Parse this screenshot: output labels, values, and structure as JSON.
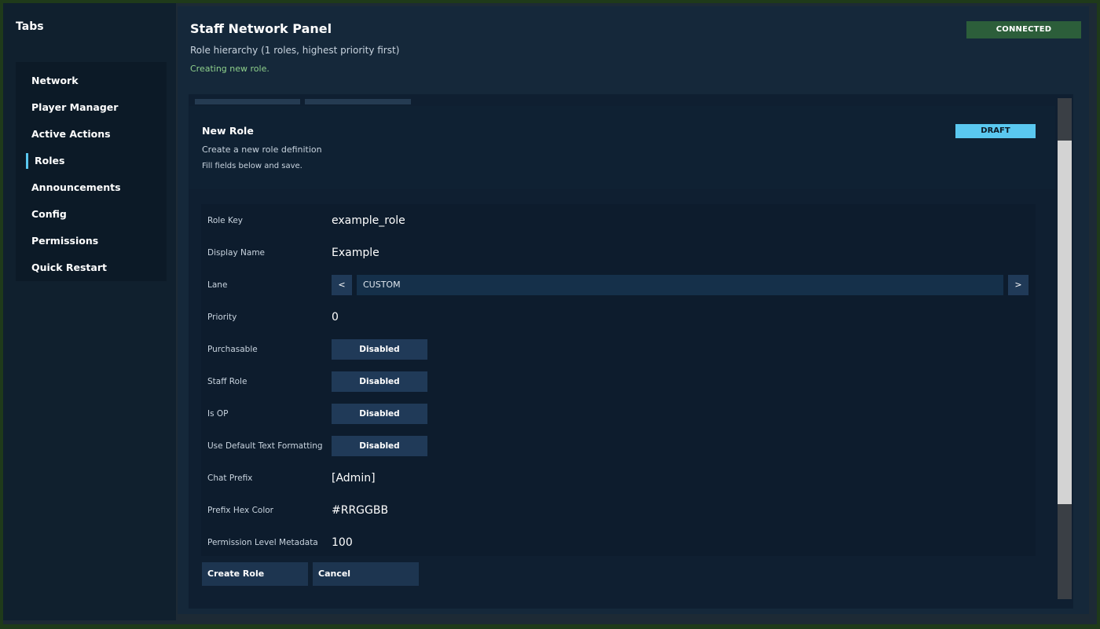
{
  "sidebar": {
    "title": "Tabs",
    "items": [
      {
        "label": "Network"
      },
      {
        "label": "Player Manager"
      },
      {
        "label": "Active Actions"
      },
      {
        "label": "Roles",
        "active": true
      },
      {
        "label": "Announcements"
      },
      {
        "label": "Config"
      },
      {
        "label": "Permissions"
      },
      {
        "label": "Quick Restart"
      }
    ]
  },
  "header": {
    "title": "Staff Network Panel",
    "subtitle": "Role hierarchy (1 roles, highest priority first)",
    "status": "Creating new role.",
    "connection_badge": "CONNECTED"
  },
  "form": {
    "title": "New Role",
    "description": "Create a new role definition",
    "hint": "Fill fields below and save.",
    "badge": "DRAFT",
    "fields": {
      "role_key": {
        "label": "Role Key",
        "value": "example_role"
      },
      "display_name": {
        "label": "Display Name",
        "value": "Example"
      },
      "lane": {
        "label": "Lane",
        "value": "CUSTOM",
        "prev": "<",
        "next": ">"
      },
      "priority": {
        "label": "Priority",
        "value": "0"
      },
      "purchasable": {
        "label": "Purchasable",
        "value": "Disabled"
      },
      "staff_role": {
        "label": "Staff Role",
        "value": "Disabled"
      },
      "is_op": {
        "label": "Is OP",
        "value": "Disabled"
      },
      "default_text_formatting": {
        "label": "Use Default Text Formatting",
        "value": "Disabled"
      },
      "chat_prefix": {
        "label": "Chat Prefix",
        "value": "[Admin]"
      },
      "prefix_hex_color": {
        "label": "Prefix Hex Color",
        "value": "#RRGGBB"
      },
      "permission_level": {
        "label": "Permission Level Metadata",
        "value": "100"
      }
    },
    "actions": {
      "create": "Create Role",
      "cancel": "Cancel"
    }
  },
  "colors": {
    "accent": "#5ac8f0",
    "connected": "#2c5e3a",
    "status_text": "#8fd18c",
    "button": "#203a58"
  }
}
